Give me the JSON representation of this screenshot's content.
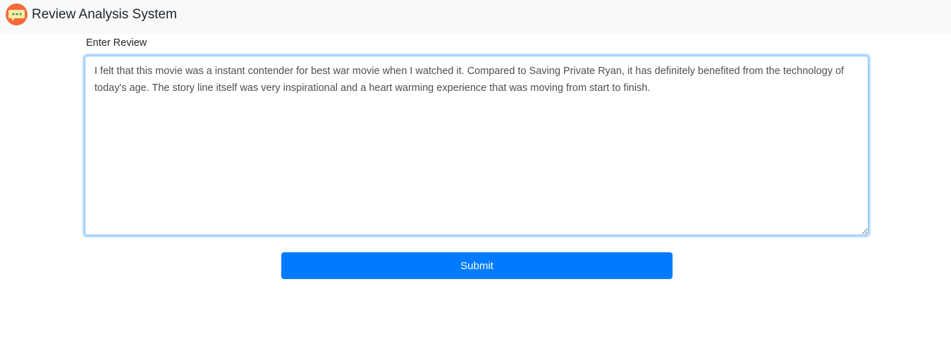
{
  "navbar": {
    "title": "Review Analysis System",
    "logo_icon": "chat-bubble-icon",
    "logo_color": "#f05a28"
  },
  "form": {
    "label": "Enter Review",
    "review_text": "I felt that this movie was a instant contender for best war movie when I watched it. Compared to Saving Private Ryan, it has definitely benefited from the technology of today's age. The story line itself was very inspirational and a heart warming experience that was moving from start to finish.",
    "submit_label": "Submit"
  },
  "colors": {
    "navbar_bg": "#f8f9fa",
    "button_bg": "#007bff",
    "focus_border": "#80bdff"
  }
}
